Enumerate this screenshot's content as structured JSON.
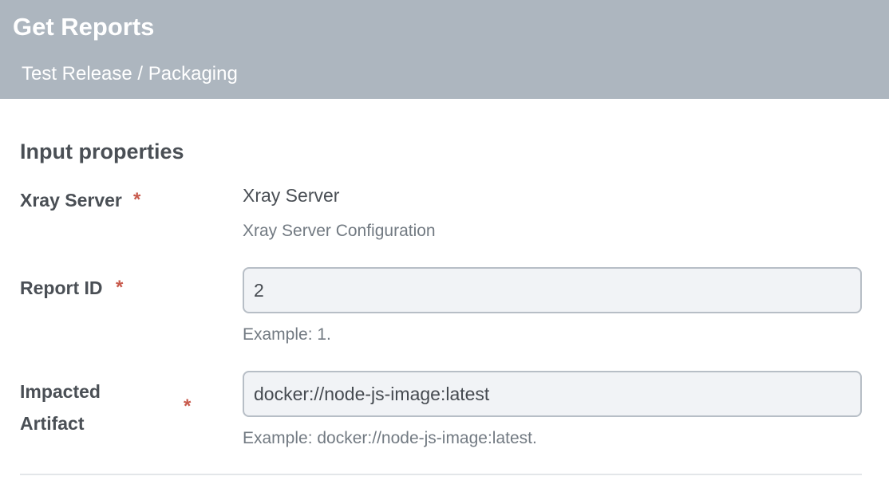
{
  "header": {
    "title": "Get Reports",
    "breadcrumb": "Test Release / Packaging"
  },
  "section": {
    "title": "Input properties"
  },
  "fields": {
    "xray_server": {
      "label": "Xray Server",
      "required_marker": "*",
      "value": "Xray Server",
      "help": "Xray Server Configuration"
    },
    "report_id": {
      "label": "Report ID",
      "required_marker": "*",
      "value": "2",
      "help": "Example: 1."
    },
    "impacted_artifact": {
      "label_line1": "Impacted",
      "label_line2": "Artifact",
      "required_marker": "*",
      "value": "docker://node-js-image:latest",
      "help": "Example: docker://node-js-image:latest."
    }
  },
  "colors": {
    "header_bg": "#adb6bf",
    "required": "#c85a4c",
    "input_bg": "#f1f3f6"
  }
}
